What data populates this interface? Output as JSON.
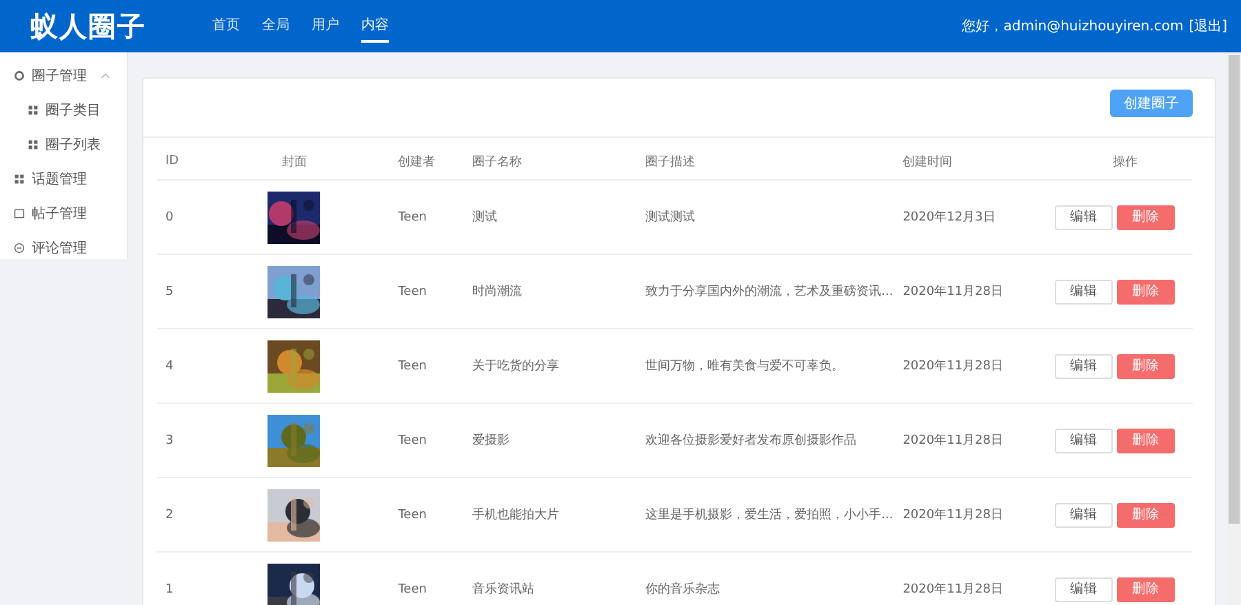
{
  "header": {
    "logo": "蚁人圈子",
    "nav": [
      {
        "label": "首页",
        "selected": false
      },
      {
        "label": "全局",
        "selected": false
      },
      {
        "label": "用户",
        "selected": false
      },
      {
        "label": "内容",
        "selected": true
      }
    ],
    "greeting": "您好，admin@huizhouyiren.com",
    "logout": "[退出]"
  },
  "sidebar": {
    "items": [
      {
        "label": "圈子管理",
        "kind": "settings",
        "expanded": true,
        "children": [
          {
            "label": "圈子类目"
          },
          {
            "label": "圈子列表"
          }
        ]
      },
      {
        "label": "话题管理",
        "kind": "topics"
      },
      {
        "label": "帖子管理",
        "kind": "posts"
      },
      {
        "label": "评论管理",
        "kind": "comments"
      }
    ]
  },
  "toolbar": {
    "create_button": "创建圈子"
  },
  "table": {
    "columns": [
      "ID",
      "封面",
      "创建者",
      "圈子名称",
      "圈子描述",
      "创建时间",
      "操作"
    ],
    "rows": [
      {
        "id": "0",
        "creator": "Teen",
        "name": "测试",
        "description": "测试测试",
        "created": "2020年12月3日",
        "edit": "编辑",
        "delete": "删除"
      },
      {
        "id": "5",
        "creator": "Teen",
        "name": "时尚潮流",
        "description": "致力于分享国内外的潮流，艺术及重磅资讯...",
        "created": "2020年11月28日",
        "edit": "编辑",
        "delete": "删除"
      },
      {
        "id": "4",
        "creator": "Teen",
        "name": "关于吃货的分享",
        "description": "世间万物，唯有美食与爱不可辜负。",
        "created": "2020年11月28日",
        "edit": "编辑",
        "delete": "删除"
      },
      {
        "id": "3",
        "creator": "Teen",
        "name": "爱摄影",
        "description": "欢迎各位摄影爱好者发布原创摄影作品",
        "created": "2020年11月28日",
        "edit": "编辑",
        "delete": "删除"
      },
      {
        "id": "2",
        "creator": "Teen",
        "name": "手机也能拍大片",
        "description": "这里是手机摄影，爱生活，爱拍照，小小手...",
        "created": "2020年11月28日",
        "edit": "编辑",
        "delete": "删除"
      },
      {
        "id": "1",
        "creator": "Teen",
        "name": "音乐资讯站",
        "description": "你的音乐杂志",
        "created": "2020年11月28日",
        "edit": "编辑",
        "delete": "删除"
      }
    ]
  }
}
